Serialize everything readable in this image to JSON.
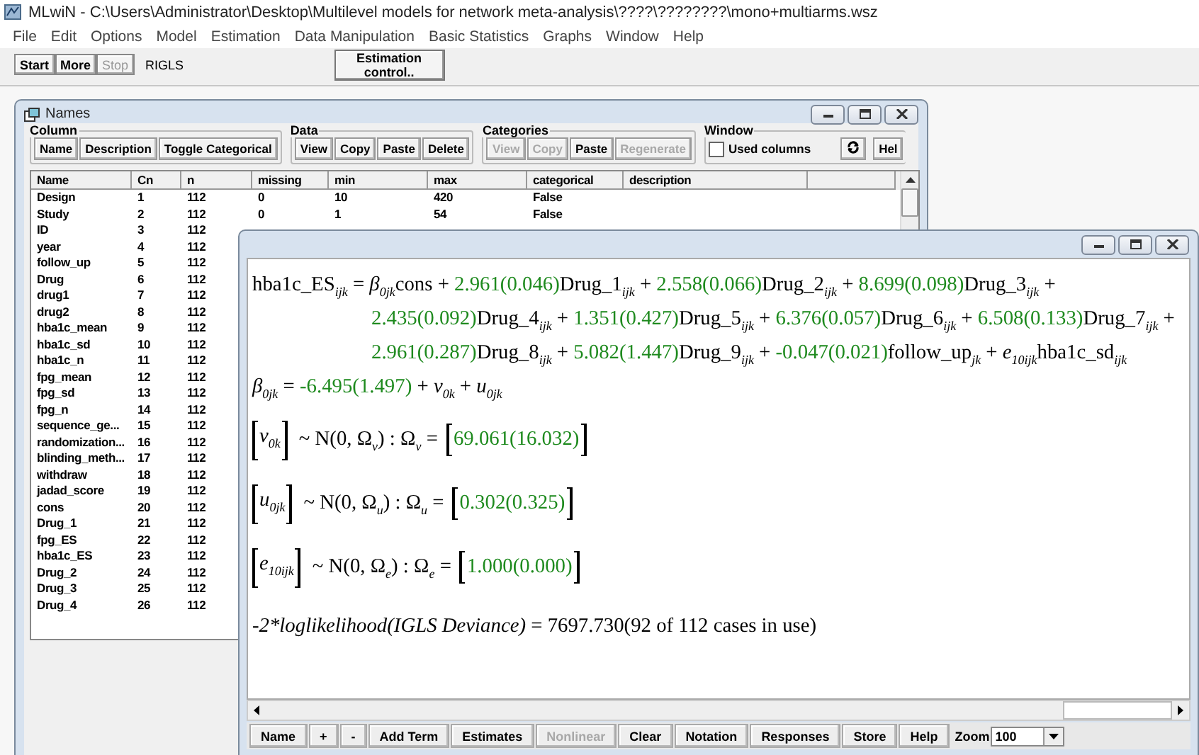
{
  "app": {
    "title": "MLwiN - C:\\Users\\Administrator\\Desktop\\Multilevel models for network meta-analysis\\????\\????????\\mono+multiarms.wsz"
  },
  "menu": [
    "File",
    "Edit",
    "Options",
    "Model",
    "Estimation",
    "Data Manipulation",
    "Basic Statistics",
    "Graphs",
    "Window",
    "Help"
  ],
  "toolbar": {
    "buttons": [
      {
        "label": "Start",
        "disabled": false
      },
      {
        "label": "More",
        "disabled": false
      },
      {
        "label": "Stop",
        "disabled": true
      }
    ],
    "method": "RIGLS",
    "estimation_button": "Estimation control.."
  },
  "names_window": {
    "title": "Names",
    "groups": [
      {
        "label": "Column",
        "buttons": [
          {
            "label": "Name",
            "disabled": false
          },
          {
            "label": "Description",
            "disabled": false
          },
          {
            "label": "Toggle Categorical",
            "disabled": false
          }
        ]
      },
      {
        "label": "Data",
        "buttons": [
          {
            "label": "View",
            "disabled": false
          },
          {
            "label": "Copy",
            "disabled": false
          },
          {
            "label": "Paste",
            "disabled": false
          },
          {
            "label": "Delete",
            "disabled": false
          }
        ]
      },
      {
        "label": "Categories",
        "buttons": [
          {
            "label": "View",
            "disabled": true
          },
          {
            "label": "Copy",
            "disabled": true
          },
          {
            "label": "Paste",
            "disabled": false
          },
          {
            "label": "Regenerate",
            "disabled": true
          }
        ]
      }
    ],
    "window_group": {
      "label": "Window",
      "checkbox": {
        "label": "Used columns",
        "checked": false
      },
      "help_button": "Hel"
    },
    "columns": [
      "Name",
      "Cn",
      "n",
      "missing",
      "min",
      "max",
      "categorical",
      "description"
    ],
    "rows": [
      {
        "name": "Design",
        "cn": "1",
        "n": "112",
        "missing": "0",
        "min": "10",
        "max": "420",
        "categorical": "False"
      },
      {
        "name": "Study",
        "cn": "2",
        "n": "112",
        "missing": "0",
        "min": "1",
        "max": "54",
        "categorical": "False"
      },
      {
        "name": "ID",
        "cn": "3",
        "n": "112"
      },
      {
        "name": "year",
        "cn": "4",
        "n": "112"
      },
      {
        "name": "follow_up",
        "cn": "5",
        "n": "112"
      },
      {
        "name": "Drug",
        "cn": "6",
        "n": "112"
      },
      {
        "name": "drug1",
        "cn": "7",
        "n": "112"
      },
      {
        "name": "drug2",
        "cn": "8",
        "n": "112"
      },
      {
        "name": "hba1c_mean",
        "cn": "9",
        "n": "112"
      },
      {
        "name": "hba1c_sd",
        "cn": "10",
        "n": "112"
      },
      {
        "name": "hba1c_n",
        "cn": "11",
        "n": "112"
      },
      {
        "name": "fpg_mean",
        "cn": "12",
        "n": "112"
      },
      {
        "name": "fpg_sd",
        "cn": "13",
        "n": "112"
      },
      {
        "name": "fpg_n",
        "cn": "14",
        "n": "112"
      },
      {
        "name": "sequence_ge...",
        "cn": "15",
        "n": "112"
      },
      {
        "name": "randomization...",
        "cn": "16",
        "n": "112"
      },
      {
        "name": "blinding_meth...",
        "cn": "17",
        "n": "112"
      },
      {
        "name": "withdraw",
        "cn": "18",
        "n": "112"
      },
      {
        "name": "jadad_score",
        "cn": "19",
        "n": "112"
      },
      {
        "name": "cons",
        "cn": "20",
        "n": "112"
      },
      {
        "name": "Drug_1",
        "cn": "21",
        "n": "112"
      },
      {
        "name": "fpg_ES",
        "cn": "22",
        "n": "112"
      },
      {
        "name": "hba1c_ES",
        "cn": "23",
        "n": "112"
      },
      {
        "name": "Drug_2",
        "cn": "24",
        "n": "112"
      },
      {
        "name": "Drug_3",
        "cn": "25",
        "n": "112"
      },
      {
        "name": "Drug_4",
        "cn": "26",
        "n": "112"
      }
    ]
  },
  "equations_window": {
    "lines": [
      {
        "indent": false,
        "tokens": [
          {
            "kind": "term",
            "text": "hba1c_ES$_{ijk}$ = *β*$_{0jk}$cons + "
          },
          {
            "kind": "estimate",
            "text": "2.961(0.046)"
          },
          {
            "kind": "term",
            "text": "Drug_1$_{ijk}$ + "
          },
          {
            "kind": "estimate",
            "text": "2.558(0.066)"
          },
          {
            "kind": "term",
            "text": "Drug_2$_{ijk}$ + "
          },
          {
            "kind": "estimate",
            "text": "8.699(0.098)"
          },
          {
            "kind": "term",
            "text": "Drug_3$_{ijk}$ +"
          }
        ]
      },
      {
        "indent": true,
        "tokens": [
          {
            "kind": "estimate",
            "text": "2.435(0.092)"
          },
          {
            "kind": "term",
            "text": "Drug_4$_{ijk}$ + "
          },
          {
            "kind": "estimate",
            "text": "1.351(0.427)"
          },
          {
            "kind": "term",
            "text": "Drug_5$_{ijk}$ + "
          },
          {
            "kind": "estimate",
            "text": "6.376(0.057)"
          },
          {
            "kind": "term",
            "text": "Drug_6$_{ijk}$ + "
          },
          {
            "kind": "estimate",
            "text": "6.508(0.133)"
          },
          {
            "kind": "term",
            "text": "Drug_7$_{ijk}$ +"
          }
        ]
      },
      {
        "indent": true,
        "tokens": [
          {
            "kind": "estimate",
            "text": "2.961(0.287)"
          },
          {
            "kind": "term",
            "text": "Drug_8$_{ijk}$ + "
          },
          {
            "kind": "estimate",
            "text": "5.082(1.447)"
          },
          {
            "kind": "term",
            "text": "Drug_9$_{ijk}$ + "
          },
          {
            "kind": "estimate",
            "text": "-0.047(0.021)"
          },
          {
            "kind": "term",
            "text": "follow_up$_{jk}$ + *e*$_{10ijk}$hba1c_sd$_{ijk}$"
          }
        ]
      },
      {
        "indent": false,
        "tokens": [
          {
            "kind": "term",
            "text": "*β*$_{0jk}$ = "
          },
          {
            "kind": "estimate",
            "text": "-6.495(1.497)"
          },
          {
            "kind": "term",
            "text": " + *v*$_{0k}$ + *u*$_{0jk}$"
          }
        ]
      }
    ],
    "variances": [
      {
        "vector": "*v*$_{0k}$",
        "dist": "~ N(0,  Ω$_{v}$)  :  Ω$_{v}$ =",
        "value": "69.061(16.032)"
      },
      {
        "vector": "*u*$_{0jk}$",
        "dist": "~ N(0,  Ω$_{u}$)  :  Ω$_{u}$ =",
        "value": "0.302(0.325)"
      },
      {
        "vector": "*e*$_{10ijk}$",
        "dist": "~ N(0,  Ω$_{e}$)  :  Ω$_{e}$ =",
        "value": "1.000(0.000)"
      }
    ],
    "deviance": {
      "label": "-2*loglikelihood(IGLS Deviance)",
      "value": " = 7697.730(92 of 112 cases in use)"
    },
    "toolbar": [
      {
        "label": "Name",
        "disabled": false
      },
      {
        "label": "+",
        "disabled": false
      },
      {
        "label": "-",
        "disabled": false
      },
      {
        "label": "Add Term",
        "disabled": false
      },
      {
        "label": "Estimates",
        "disabled": false
      },
      {
        "label": "Nonlinear",
        "disabled": true
      },
      {
        "label": "Clear",
        "disabled": false
      },
      {
        "label": "Notation",
        "disabled": false
      },
      {
        "label": "Responses",
        "disabled": false
      },
      {
        "label": "Store",
        "disabled": false
      },
      {
        "label": "Help",
        "disabled": false
      }
    ],
    "zoom": {
      "label": "Zoom",
      "value": "100"
    }
  }
}
